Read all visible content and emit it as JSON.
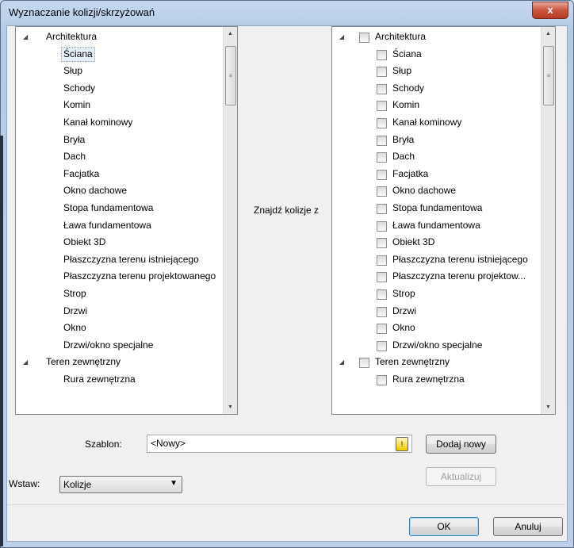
{
  "window": {
    "title": "Wyznaczanie kolizji/skrzyżowań",
    "close_glyph": "x"
  },
  "left_tree": {
    "items": [
      {
        "label": "Architektura",
        "level": 0,
        "expanded": true
      },
      {
        "label": "Ściana",
        "level": 1,
        "selected": true
      },
      {
        "label": "Słup",
        "level": 1
      },
      {
        "label": "Schody",
        "level": 1
      },
      {
        "label": "Komin",
        "level": 1
      },
      {
        "label": "Kanał kominowy",
        "level": 1
      },
      {
        "label": "Bryła",
        "level": 1
      },
      {
        "label": "Dach",
        "level": 1
      },
      {
        "label": "Facjatka",
        "level": 1
      },
      {
        "label": "Okno dachowe",
        "level": 1
      },
      {
        "label": "Stopa fundamentowa",
        "level": 1
      },
      {
        "label": "Ława fundamentowa",
        "level": 1
      },
      {
        "label": "Obiekt 3D",
        "level": 1
      },
      {
        "label": "Płaszczyzna terenu istniejącego",
        "level": 1
      },
      {
        "label": "Płaszczyzna terenu projektowanego",
        "level": 1
      },
      {
        "label": "Strop",
        "level": 1
      },
      {
        "label": "Drzwi",
        "level": 1
      },
      {
        "label": "Okno",
        "level": 1
      },
      {
        "label": "Drzwi/okno specjalne",
        "level": 1
      },
      {
        "label": "Teren zewnętrzny",
        "level": 0,
        "expanded": true
      },
      {
        "label": "Rura zewnętrzna",
        "level": 1
      }
    ]
  },
  "find_label": "Znajdź kolizje z",
  "right_tree": {
    "items": [
      {
        "label": "Architektura",
        "level": 0,
        "expanded": true,
        "checked": false
      },
      {
        "label": "Ściana",
        "level": 1,
        "checked": false
      },
      {
        "label": "Słup",
        "level": 1,
        "checked": false
      },
      {
        "label": "Schody",
        "level": 1,
        "checked": false
      },
      {
        "label": "Komin",
        "level": 1,
        "checked": false
      },
      {
        "label": "Kanał kominowy",
        "level": 1,
        "checked": false
      },
      {
        "label": "Bryła",
        "level": 1,
        "checked": false
      },
      {
        "label": "Dach",
        "level": 1,
        "checked": false
      },
      {
        "label": "Facjatka",
        "level": 1,
        "checked": false
      },
      {
        "label": "Okno dachowe",
        "level": 1,
        "checked": false
      },
      {
        "label": "Stopa fundamentowa",
        "level": 1,
        "checked": false
      },
      {
        "label": "Ława fundamentowa",
        "level": 1,
        "checked": false
      },
      {
        "label": "Obiekt 3D",
        "level": 1,
        "checked": false
      },
      {
        "label": "Płaszczyzna terenu istniejącego",
        "level": 1,
        "checked": false
      },
      {
        "label": "Płaszczyzna terenu projektow...",
        "level": 1,
        "checked": false
      },
      {
        "label": "Strop",
        "level": 1,
        "checked": false
      },
      {
        "label": "Drzwi",
        "level": 1,
        "checked": false
      },
      {
        "label": "Okno",
        "level": 1,
        "checked": false
      },
      {
        "label": "Drzwi/okno specjalne",
        "level": 1,
        "checked": false
      },
      {
        "label": "Teren zewnętrzny",
        "level": 0,
        "expanded": true,
        "checked": false
      },
      {
        "label": "Rura zewnętrzna",
        "level": 1,
        "checked": false
      }
    ]
  },
  "template": {
    "label": "Szablon:",
    "value": "<Nowy>",
    "add_new_label": "Dodaj nowy",
    "update_label": "Aktualizuj"
  },
  "insert": {
    "label": "Wstaw:",
    "value": "Kolizje"
  },
  "footer": {
    "ok_label": "OK",
    "cancel_label": "Anuluj"
  }
}
